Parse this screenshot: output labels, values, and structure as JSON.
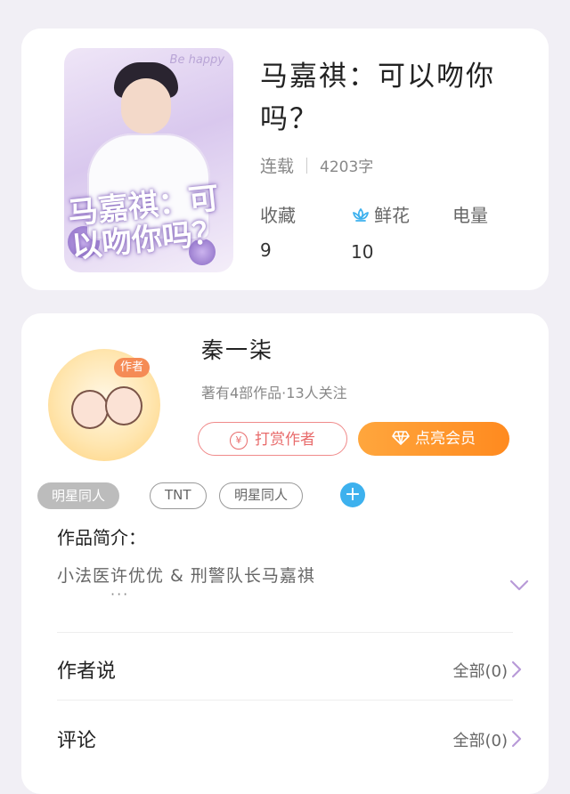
{
  "book": {
    "cover_corner_text": "Be happy",
    "cover_title_art": "马嘉祺：可以吻你吗？",
    "title": "马嘉祺：可以吻你吗？",
    "status": "连载",
    "word_count": "4203字",
    "stats": [
      {
        "label": "收藏",
        "value": "9",
        "icon": null
      },
      {
        "label": "鲜花",
        "value": "10",
        "icon": "flower-icon"
      },
      {
        "label": "电量",
        "value": "",
        "icon": null
      }
    ]
  },
  "author": {
    "avatar_tag": "作者",
    "name": "秦一柒",
    "summary": "著有4部作品·13人关注",
    "reward_label": "打赏作者",
    "reward_icon": "¥",
    "vip_label": "点亮会员",
    "tags": [
      "明星同人",
      "TNT",
      "明星同人"
    ],
    "add_tag_label": "+"
  },
  "intro": {
    "title": "作品简介：",
    "text": "小法医许优优 & 刑警队长马嘉祺",
    "ellipsis": "···"
  },
  "rows": [
    {
      "label": "作者说",
      "right": "全部(0)"
    },
    {
      "label": "评论",
      "right": "全部(0)"
    }
  ],
  "colors": {
    "accent_orange": "#ff8a1f",
    "reward_red": "#e86b6b",
    "flower_blue": "#3db1ee",
    "expand_purple": "#b89ad8"
  }
}
